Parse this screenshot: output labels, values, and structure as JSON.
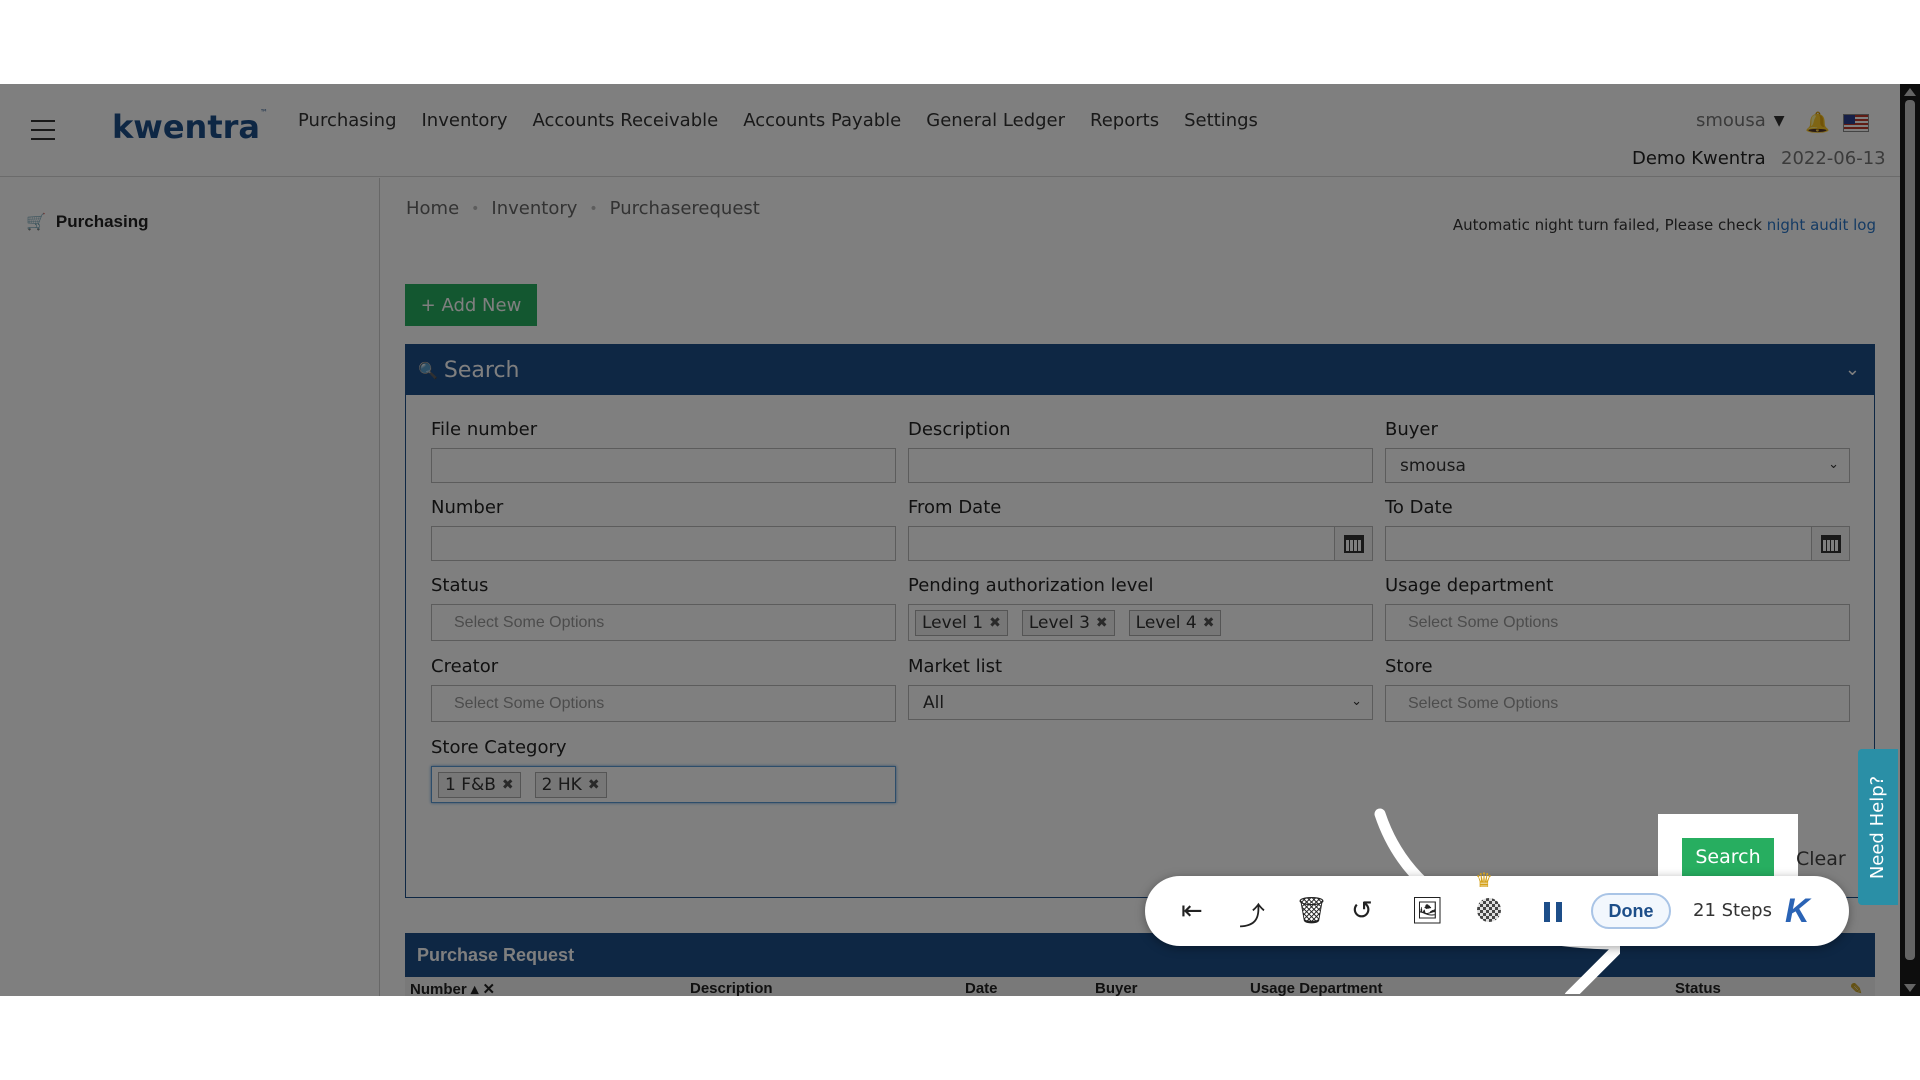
{
  "header": {
    "logo": "kwentra",
    "logo_tm": "™",
    "nav": [
      "Purchasing",
      "Inventory",
      "Accounts Receivable",
      "Accounts Payable",
      "General Ledger",
      "Reports",
      "Settings"
    ],
    "user": "smousa",
    "company": "Demo Kwentra",
    "date": "2022-06-13"
  },
  "sidebar": {
    "items": [
      {
        "label": "Purchasing",
        "icon": "cart-icon"
      }
    ]
  },
  "breadcrumb": [
    "Home",
    "Inventory",
    "Purchaserequest"
  ],
  "alert": {
    "text": "Automatic night turn failed, Please check ",
    "link": "night audit log"
  },
  "add_new_label": "+ Add New",
  "search_panel": {
    "title": "Search",
    "fields": {
      "file_number": {
        "label": "File number",
        "value": ""
      },
      "description": {
        "label": "Description",
        "value": ""
      },
      "buyer": {
        "label": "Buyer",
        "value": "smousa"
      },
      "number": {
        "label": "Number",
        "value": ""
      },
      "from_date": {
        "label": "From Date",
        "value": ""
      },
      "to_date": {
        "label": "To Date",
        "value": ""
      },
      "status": {
        "label": "Status",
        "placeholder": "Select Some Options"
      },
      "pending_level": {
        "label": "Pending authorization level",
        "tags": [
          "Level 1",
          "Level 3",
          "Level 4"
        ]
      },
      "usage_department": {
        "label": "Usage department",
        "placeholder": "Select Some Options"
      },
      "creator": {
        "label": "Creator",
        "placeholder": "Select Some Options"
      },
      "market_list": {
        "label": "Market list",
        "value": "All"
      },
      "store": {
        "label": "Store",
        "placeholder": "Select Some Options"
      },
      "store_category": {
        "label": "Store Category",
        "tags": [
          "1 F&B",
          "2 HK"
        ]
      }
    },
    "search_label": "Search",
    "clear_label": "Clear"
  },
  "purchase_request": {
    "title": "Purchase Request",
    "columns": [
      "Number ▴ ✕",
      "Description",
      "Date",
      "Buyer",
      "Usage Department",
      "Status"
    ]
  },
  "help_label": "Need Help?",
  "recorder": {
    "done_label": "Done",
    "steps_label": "21 Steps",
    "logo": "K"
  }
}
